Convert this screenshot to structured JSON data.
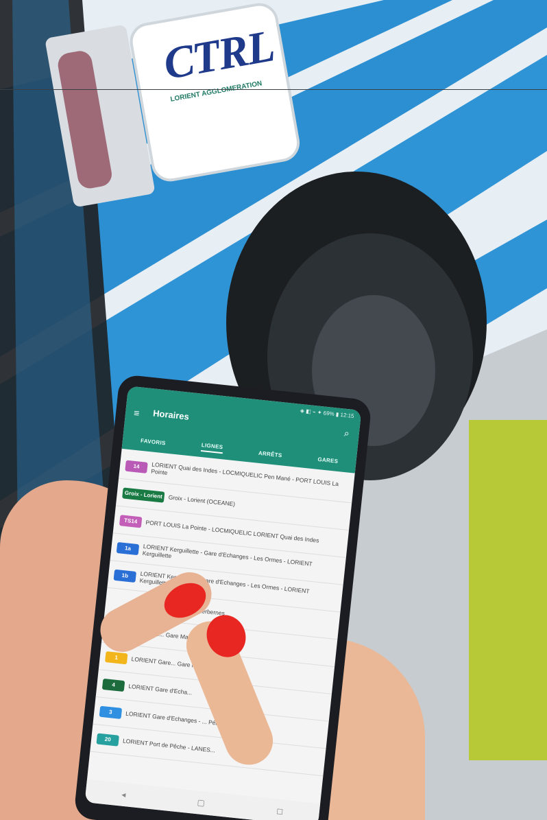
{
  "scene": {
    "bus_logo_text": "CTRL",
    "bus_logo_subtext": "LORIENT AGGLOMERATION"
  },
  "app": {
    "status_text": "◈ ◧ ⌁ ✦ 69% ▮ 12:15",
    "title": "Horaires",
    "tabs": [
      {
        "label": "FAVORIS"
      },
      {
        "label": "LIGNES"
      },
      {
        "label": "ARRÊTS"
      },
      {
        "label": "GARES"
      }
    ],
    "rows": [
      {
        "badge": "14",
        "color": "#b95bb6",
        "text": "LORIENT Quai des Indes - LOCMIQUELIC Pen Mané - PORT LOUIS La Pointe"
      },
      {
        "badge": "Groix - Lorient",
        "color": "#1a7a44",
        "text": "Groix - Lorient (OCEANE)"
      },
      {
        "badge": "TS14",
        "color": "#c35fb8",
        "text": "PORT LOUIS La Pointe - LOCMIQUELIC LORIENT Quai des Indes"
      },
      {
        "badge": "1a",
        "color": "#2a6fd6",
        "text": "LORIENT Kerguillette - Gare d'Echanges - Les Ormes - LORIENT Kerguillette"
      },
      {
        "badge": "1b",
        "color": "#2a6fd6",
        "text": "LORIENT Kerguillette - Gare d'Echanges - Les Ormes - LORIENT Kerguillette"
      },
      {
        "badge": "",
        "color": "#2a6fd6",
        "text": "...uillette - PLOEMEUR Kerbernes"
      },
      {
        "badge": "",
        "color": "#2a6fd6",
        "text": "...ENT Ke... Gare Maritime"
      },
      {
        "badge": "1",
        "color": "#f2b51c",
        "text": "LORIENT Gare... Gare Maritime"
      },
      {
        "badge": "4",
        "color": "#1b6b3c",
        "text": "LORIENT Gare d'Echa..."
      },
      {
        "badge": "3",
        "color": "#2f8fe0",
        "text": "LORIENT Gare d'Echanges - ... Péristyle"
      },
      {
        "badge": "20",
        "color": "#27a1a0",
        "text": "LORIENT Port de Pêche - LANES..."
      }
    ],
    "nav": [
      "◂",
      "▢",
      "◻"
    ]
  }
}
